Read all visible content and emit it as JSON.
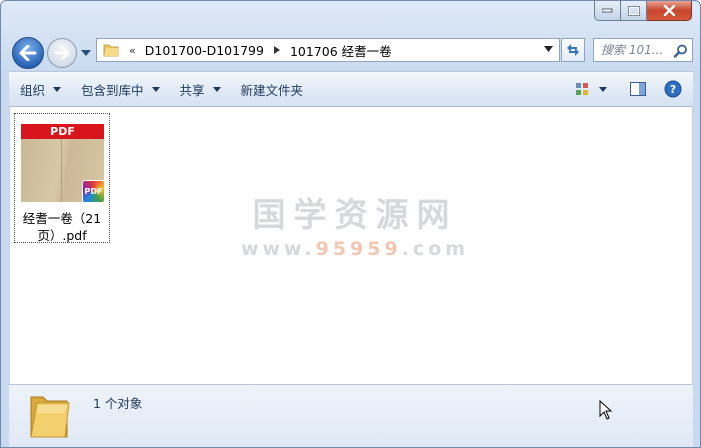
{
  "window": {
    "caption_buttons": [
      "minimize",
      "maximize",
      "close"
    ]
  },
  "address_bar": {
    "overflow_chevron": "«",
    "breadcrumbs": [
      "D101700-D101799",
      "101706 经耆一卷"
    ]
  },
  "search": {
    "placeholder": "搜索 101..."
  },
  "toolbar": {
    "organize": "组织",
    "include_in_library": "包含到库中",
    "share": "共享",
    "new_folder": "新建文件夹"
  },
  "files": [
    {
      "name": "经耆一卷（21页）.pdf",
      "name_line1": "经耆一卷（21",
      "name_line2": "页）.pdf",
      "thumb_banner": "PDF",
      "badge": "PDF"
    }
  ],
  "watermark": {
    "title": "国学资源网",
    "url_prefix": "www.",
    "url_highlight": "95959",
    "url_suffix": ".com"
  },
  "details": {
    "count_text": "1 个对象"
  },
  "colors": {
    "accent": "#1e395b",
    "close_red": "#c7452c",
    "pdf_red": "#d8141c"
  }
}
